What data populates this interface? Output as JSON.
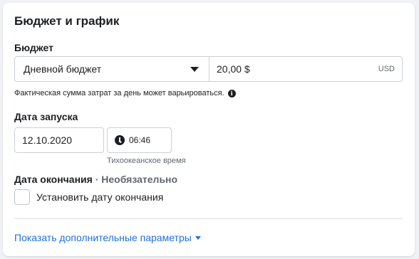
{
  "card": {
    "title": "Бюджет и график"
  },
  "budget": {
    "label": "Бюджет",
    "type_selected": "Дневной бюджет",
    "amount": "20,00 $",
    "currency": "USD",
    "help_text": "Фактическая сумма затрат за день может варьироваться."
  },
  "start": {
    "label": "Дата запуска",
    "date": "12.10.2020",
    "time": "06:46",
    "timezone": "Тихоокеанское время"
  },
  "end": {
    "label": "Дата окончания",
    "optional": "· Необязательно",
    "checkbox_label": "Установить дату окончания",
    "checked": false
  },
  "more": {
    "label": "Показать дополнительные параметры"
  },
  "colors": {
    "link": "#216fdb",
    "text": "#1c1e21",
    "muted": "#606770",
    "border": "#ccd0d5"
  },
  "icons": [
    "chevron-down-icon",
    "info-icon",
    "clock-icon"
  ]
}
